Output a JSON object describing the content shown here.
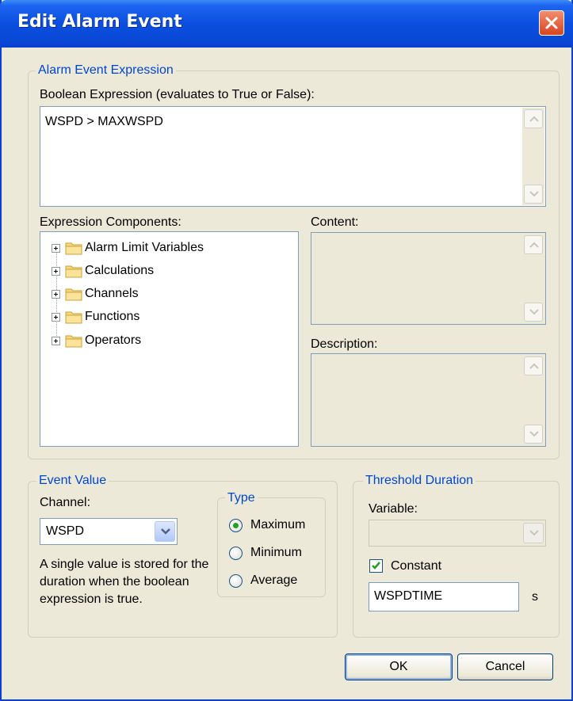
{
  "window": {
    "title": "Edit Alarm Event"
  },
  "expression_group": {
    "legend": "Alarm Event Expression",
    "boolean_label": "Boolean Expression (evaluates to True or False):",
    "boolean_value": "WSPD > MAXWSPD",
    "components_label": "Expression Components:",
    "components": [
      {
        "label": "Alarm Limit Variables"
      },
      {
        "label": "Calculations"
      },
      {
        "label": "Channels"
      },
      {
        "label": "Functions"
      },
      {
        "label": "Operators"
      }
    ],
    "content_label": "Content:",
    "description_label": "Description:"
  },
  "event_value": {
    "legend": "Event Value",
    "channel_label": "Channel:",
    "channel_value": "WSPD",
    "info": "A single value is stored for the duration when the boolean expression is true.",
    "type": {
      "legend": "Type",
      "options": [
        {
          "label": "Maximum",
          "checked": true
        },
        {
          "label": "Minimum",
          "checked": false
        },
        {
          "label": "Average",
          "checked": false
        }
      ]
    }
  },
  "threshold": {
    "legend": "Threshold Duration",
    "variable_label": "Variable:",
    "variable_value": "",
    "constant_label": "Constant",
    "constant_checked": true,
    "constant_value": "WSPDTIME",
    "unit": "s"
  },
  "buttons": {
    "ok": "OK",
    "cancel": "Cancel"
  },
  "colors": {
    "title_bar": "#0a48d6",
    "group_legend": "#0046d5",
    "dialog_bg": "#ece9d8",
    "close_button": "#d8441f",
    "radio_dot": "#21a121"
  }
}
